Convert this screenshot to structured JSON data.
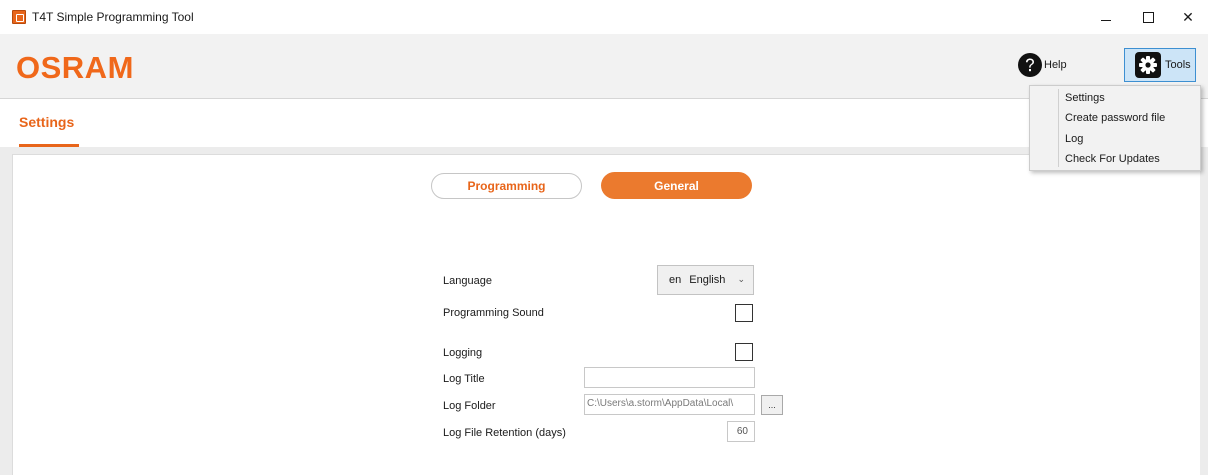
{
  "window": {
    "title": "T4T Simple Programming Tool",
    "close_glyph": "✕"
  },
  "header": {
    "logo": "OSRAM",
    "help_label": "Help",
    "tools_label": "Tools"
  },
  "page": {
    "tab_label": "Settings"
  },
  "toggle": {
    "programming": "Programming",
    "general": "General",
    "selected": "General"
  },
  "settings": {
    "language_label": "Language",
    "language_code": "en",
    "language_name": "English",
    "programming_sound_label": "Programming Sound",
    "programming_sound_checked": false,
    "logging_label": "Logging",
    "logging_checked": false,
    "log_title_label": "Log Title",
    "log_title_value": "",
    "log_folder_label": "Log Folder",
    "log_folder_value": "C:\\Users\\a.storm\\AppData\\Local\\",
    "browse_label": "...",
    "retention_label": "Log File Retention (days)",
    "retention_value": "60"
  },
  "tools_menu": {
    "items": [
      "Settings",
      "Create password file",
      "Log",
      "Check For Updates"
    ]
  },
  "colors": {
    "brand": "#e8651a",
    "selected_button": "#eb7a2e",
    "tools_highlight": "#cce4f7"
  },
  "icons": {
    "app": "app-icon",
    "help": "question-circle-icon",
    "tools": "gear-icon"
  }
}
